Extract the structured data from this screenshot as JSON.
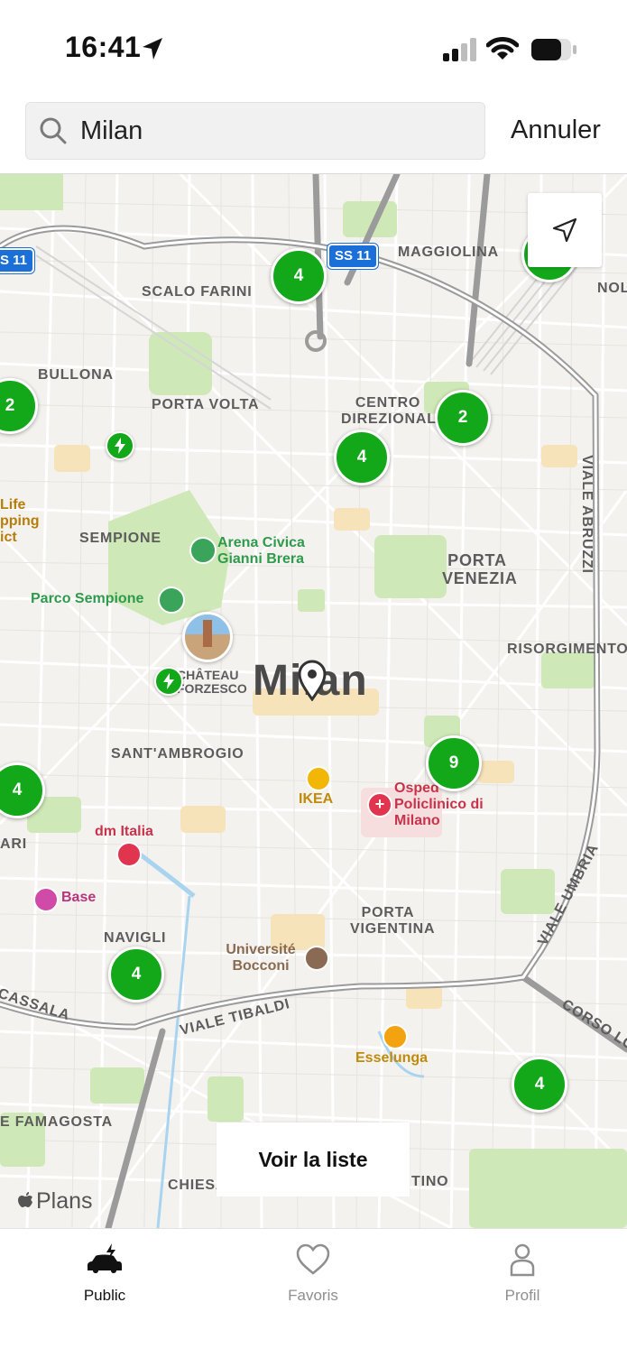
{
  "status_bar": {
    "time": "16:41"
  },
  "search": {
    "value": "Milan",
    "cancel_label": "Annuler"
  },
  "map": {
    "city_label": "Milan",
    "highway_shields": [
      "SS 11",
      "S 11"
    ],
    "district_labels": {
      "maggiolina": "MAGGIOLINA",
      "scalo_farini": "SCALO FARINI",
      "nolo": "NOLO",
      "bullona": "BULLONA",
      "porta_volta": "PORTA VOLTA",
      "centro_direzionale": "CENTRO DIREZIONALE",
      "viale_abruzzi": "VIALE ABRUZZI",
      "sempione": "SEMPIONE",
      "porta_venezia": "PORTA VENEZIA",
      "risorgimento": "RISORGIMENTO",
      "sant_ambrogio": "SANT'AMBROGIO",
      "ari": "ARI",
      "porta_vigentina": "PORTA VIGENTINA",
      "navigli": "NAVIGLI",
      "viale_umbria": "VIALE UMBRIA",
      "cassala": "CASSALA",
      "viale_tibaldi": "VIALE TIBALDI",
      "corso_lodi": "CORSO LOD",
      "famagosta": "E FAMAGOSTA",
      "chiesa": "CHIESA",
      "tino": "TINO",
      "chateau": "CHÂTEAU FORZESCO"
    },
    "poi_labels": {
      "arena": "Arena Civica Gianni Brera",
      "parco": "Parco Sempione",
      "life_shopping": "Life pping ict",
      "ikea": "IKEA",
      "ospedale": "Osped Policlinico di Milano",
      "dm_italia": "dm Italia",
      "base": "Base",
      "bocconi": "Université Bocconi",
      "esselunga": "Esselunga"
    },
    "clusters": [
      "4",
      "2",
      "2",
      "4",
      "9",
      "4",
      "4",
      "4"
    ],
    "list_button_label": "Voir la liste",
    "attribution": "Plans"
  },
  "tabs": [
    {
      "label": "Public",
      "icon": "car-charger-icon",
      "active": true
    },
    {
      "label": "Favoris",
      "icon": "heart-icon",
      "active": false
    },
    {
      "label": "Profil",
      "icon": "person-icon",
      "active": false
    }
  ],
  "colors": {
    "cluster": "#13a81a",
    "shield": "#1b6fd8",
    "park": "#cfe8b7",
    "road": "#ffffff",
    "major_road": "#9b9b9b"
  }
}
